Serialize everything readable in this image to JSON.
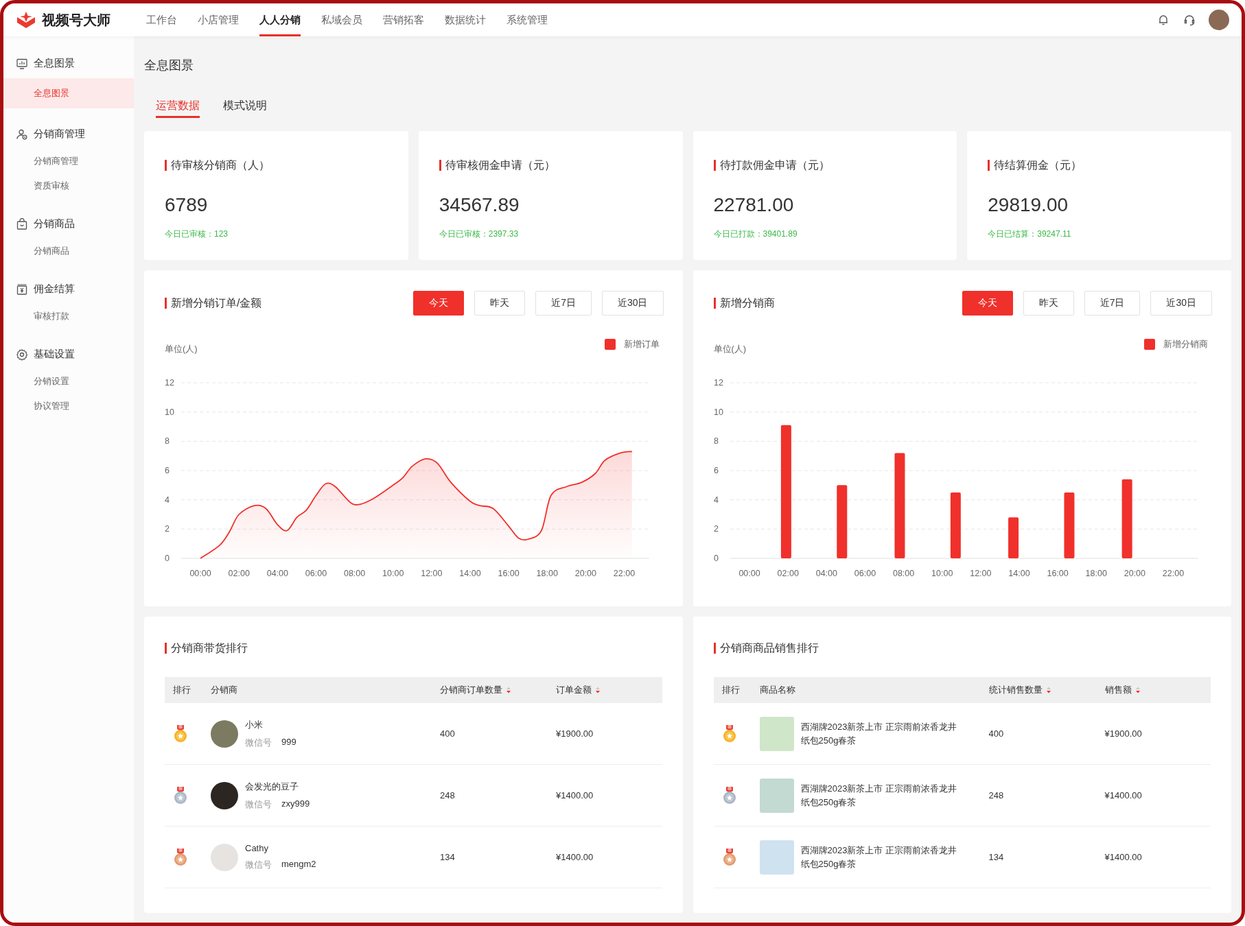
{
  "app": {
    "name": "视频号大师"
  },
  "nav": [
    {
      "label": "工作台",
      "selected": false
    },
    {
      "label": "小店管理",
      "selected": false
    },
    {
      "label": "人人分销",
      "selected": true
    },
    {
      "label": "私域会员",
      "selected": false
    },
    {
      "label": "营销拓客",
      "selected": false
    },
    {
      "label": "数据统计",
      "selected": false
    },
    {
      "label": "系统管理",
      "selected": false
    }
  ],
  "sidebar": {
    "groups": [
      {
        "label": "全息图景",
        "items": [
          {
            "label": "全息图景",
            "selected": true
          }
        ]
      },
      {
        "label": "分销商管理",
        "items": [
          {
            "label": "分销商管理",
            "selected": false
          },
          {
            "label": "资质审核",
            "selected": false
          }
        ]
      },
      {
        "label": "分销商品",
        "items": [
          {
            "label": "分销商品",
            "selected": false
          }
        ]
      },
      {
        "label": "佣金结算",
        "items": [
          {
            "label": "审核打款",
            "selected": false
          }
        ]
      },
      {
        "label": "基础设置",
        "items": [
          {
            "label": "分销设置",
            "selected": false
          },
          {
            "label": "协议管理",
            "selected": false
          }
        ]
      }
    ]
  },
  "page_title": "全息图景",
  "tabs": [
    {
      "label": "运营数据",
      "selected": true
    },
    {
      "label": "模式说明",
      "selected": false
    }
  ],
  "stats": [
    {
      "title": "待审核分销商（人）",
      "value": "6789",
      "note": "今日已审核：123"
    },
    {
      "title": "待审核佣金申请（元）",
      "value": "34567.89",
      "note": "今日已审核：2397.33"
    },
    {
      "title": "待打款佣金申请（元）",
      "value": "22781.00",
      "note": "今日已打款：39401.89"
    },
    {
      "title": "待结算佣金（元）",
      "value": "29819.00",
      "note": "今日已结算：39247.11"
    }
  ],
  "charts": [
    {
      "title": "新增分销订单/金额",
      "ranges": [
        {
          "label": "今天",
          "selected": true
        },
        {
          "label": "昨天",
          "selected": false
        },
        {
          "label": "近7日",
          "selected": false
        },
        {
          "label": "近30日",
          "selected": false
        }
      ],
      "unit": "单位(人)",
      "chart_data": {
        "type": "area",
        "x": [
          0,
          1,
          1.5,
          2,
          2.8,
          3.4,
          4,
          4.5,
          5,
          5.5,
          6,
          6.5,
          7,
          7.8,
          8.3,
          9,
          10,
          10.5,
          11,
          11.7,
          12.3,
          13,
          14,
          14.5,
          15.2,
          16,
          16.5,
          17,
          17.7,
          18.2,
          19,
          19.8,
          20.5,
          21,
          21.8,
          22.4
        ],
        "series": [
          {
            "name": "新增订单",
            "color": "#f0302b",
            "values": [
              0,
              0.9,
              1.8,
              3.0,
              3.6,
              3.4,
              2.3,
              1.9,
              2.8,
              3.3,
              4.3,
              5.1,
              4.9,
              3.8,
              3.7,
              4.1,
              5.0,
              5.5,
              6.3,
              6.8,
              6.5,
              5.2,
              3.9,
              3.6,
              3.4,
              2.2,
              1.4,
              1.3,
              1.9,
              4.3,
              4.9,
              5.2,
              5.8,
              6.7,
              7.2,
              7.3
            ]
          }
        ],
        "xlim": [
          -1,
          23.3
        ],
        "ylim": [
          0,
          12
        ],
        "grid": true,
        "yticks": [
          0,
          2,
          4,
          6,
          8,
          10,
          12
        ],
        "xticks": [
          {
            "value": 0,
            "label": "00:00"
          },
          {
            "value": 2,
            "label": "02:00"
          },
          {
            "value": 4,
            "label": "04:00"
          },
          {
            "value": 6,
            "label": "06:00"
          },
          {
            "value": 8,
            "label": "08:00"
          },
          {
            "value": 10,
            "label": "10:00"
          },
          {
            "value": 12,
            "label": "12:00"
          },
          {
            "value": 14,
            "label": "14:00"
          },
          {
            "value": 16,
            "label": "16:00"
          },
          {
            "value": 18,
            "label": "18:00"
          },
          {
            "value": 20,
            "label": "20:00"
          },
          {
            "value": 22,
            "label": "22:00"
          }
        ]
      }
    },
    {
      "title": "新增分销商",
      "ranges": [
        {
          "label": "今天",
          "selected": true
        },
        {
          "label": "昨天",
          "selected": false
        },
        {
          "label": "近7日",
          "selected": false
        },
        {
          "label": "近30日",
          "selected": false
        }
      ],
      "unit": "单位(人)",
      "chart_data": {
        "type": "bar",
        "x": [
          1.9,
          4.8,
          7.8,
          10.7,
          13.7,
          16.6,
          19.6
        ],
        "series": [
          {
            "name": "新增分销商",
            "color": "#f0302b",
            "values": [
              9.1,
              5.0,
              7.2,
              4.5,
              2.8,
              4.5,
              5.4
            ]
          }
        ],
        "xlim": [
          -1,
          23.3
        ],
        "ylim": [
          0,
          12
        ],
        "grid": true,
        "yticks": [
          0,
          2,
          4,
          6,
          8,
          10,
          12
        ],
        "xticks": [
          {
            "value": 0,
            "label": "00:00"
          },
          {
            "value": 2,
            "label": "02:00"
          },
          {
            "value": 4,
            "label": "04:00"
          },
          {
            "value": 6,
            "label": "06:00"
          },
          {
            "value": 8,
            "label": "08:00"
          },
          {
            "value": 10,
            "label": "10:00"
          },
          {
            "value": 12,
            "label": "12:00"
          },
          {
            "value": 14,
            "label": "14:00"
          },
          {
            "value": 16,
            "label": "16:00"
          },
          {
            "value": 18,
            "label": "18:00"
          },
          {
            "value": 20,
            "label": "20:00"
          },
          {
            "value": 22,
            "label": "22:00"
          }
        ]
      }
    }
  ],
  "rankings": [
    {
      "title": "分销商带货排行",
      "kind": "person",
      "columns": [
        "排行",
        "分销商",
        "分销商订单数量",
        "订单金额"
      ],
      "rows": [
        {
          "color": "#f7b21c",
          "name": "小米",
          "wechat_label": "微信号",
          "wechat": "999",
          "count": "400",
          "amount": "¥1900.00"
        },
        {
          "color": "#a9b6c4",
          "name": "会发光的豆子",
          "wechat_label": "微信号",
          "wechat": "zxy999",
          "count": "248",
          "amount": "¥1400.00"
        },
        {
          "color": "#e49a6a",
          "name": "Cathy",
          "wechat_label": "微信号",
          "wechat": "mengm2",
          "count": "134",
          "amount": "¥1400.00"
        }
      ]
    },
    {
      "title": "分销商商品销售排行",
      "kind": "product",
      "columns": [
        "排行",
        "商品名称",
        "统计销售数量",
        "销售额"
      ],
      "rows": [
        {
          "color": "#f7b21c",
          "name": "西湖牌2023新茶上市 正宗雨前浓香龙井纸包250g春茶",
          "count": "400",
          "amount": "¥1900.00"
        },
        {
          "color": "#a9b6c4",
          "name": "西湖牌2023新茶上市 正宗雨前浓香龙井纸包250g春茶",
          "count": "248",
          "amount": "¥1400.00"
        },
        {
          "color": "#e49a6a",
          "name": "西湖牌2023新茶上市 正宗雨前浓香龙井纸包250g春茶",
          "count": "134",
          "amount": "¥1400.00"
        }
      ]
    }
  ]
}
